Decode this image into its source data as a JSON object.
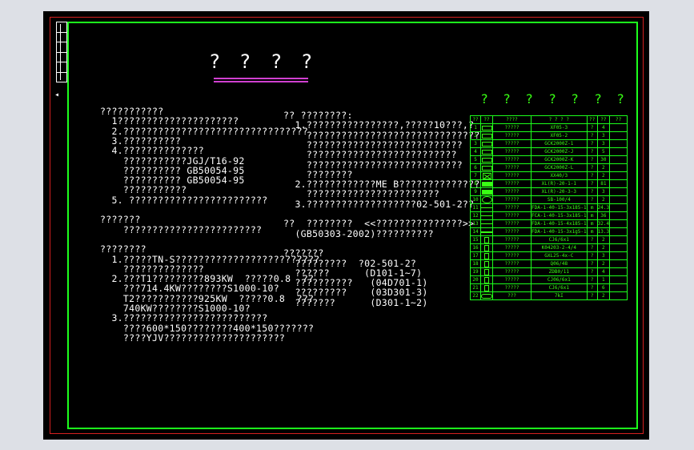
{
  "title_chars": [
    "?",
    "?",
    "?",
    "?"
  ],
  "left_text": [
    "???????????",
    "  1?????????????????????",
    "  2.????????????????????????????????",
    "  3.??????????",
    "  4.??????????????",
    "    ???????????JGJ/T16-92",
    "    ?????????? GB50054-95",
    "    ?????????? GB50054-95",
    "    ???????????",
    "  5. ????????????????????????",
    "",
    "???????",
    "    ????????????????????????",
    "",
    "????????",
    "  1.?????TN-S?????????????????????????",
    "    ??????????????",
    "  2.???T1?????????893KW  ?????0.8  ??",
    "    ???714.4KW????????S1000-10?",
    "    T2???????????925KW  ?????0.8  ???",
    "    740KW????????S1000-10?",
    "  3.?????????????????????????",
    "    ????600*150????????400*150???????",
    "    ????YJV?????????????????????"
  ],
  "mid_text": [
    "?? ????????:",
    "  1.????????????????,?????10???,?",
    "    ??????????????????????????????",
    "    ???????????????????????????",
    "    ??????????????????????????",
    "    ???????????????????????????",
    "    ????????",
    "  2.????????????ME B??????????????",
    "    ???????????????????????",
    "  3.???????????????????02-501-2??",
    "",
    "??  ????????  <<???????????????>>",
    "  (GB50303-2002)??????????",
    "",
    "???????",
    "  ?????????  ?02-501-2?",
    "  ??????      (D101-1~7)",
    "  ??????????   (04D701-1)",
    "  ?????????    (03D301-3)",
    "  ???????      (D301-1~2)"
  ],
  "legend": {
    "heading": [
      "?",
      "?",
      "?",
      "?",
      "?",
      "?",
      "?"
    ],
    "columns": [
      "??",
      "??",
      "????",
      "? ? ? ?",
      "??",
      "??",
      "??"
    ],
    "rows": [
      {
        "no": "1",
        "sym": "rect",
        "name": "?????",
        "model": "XF05-3",
        "unit": "?",
        "qty": "4"
      },
      {
        "no": "2",
        "sym": "rect",
        "name": "?????",
        "model": "XF05-2",
        "unit": "?",
        "qty": "3"
      },
      {
        "no": "3",
        "sym": "rect",
        "name": "?????",
        "model": "GCK2000Z-1",
        "unit": "?",
        "qty": "3"
      },
      {
        "no": "4",
        "sym": "rect",
        "name": "?????",
        "model": "GCK2000Z-J",
        "unit": "?",
        "qty": "5"
      },
      {
        "no": "5",
        "sym": "rect",
        "name": "?????",
        "model": "GCK2000Z-K",
        "unit": "?",
        "qty": "30"
      },
      {
        "no": "6",
        "sym": "rect",
        "name": "?????",
        "model": "GCK2000Z-L",
        "unit": "?",
        "qty": "2"
      },
      {
        "no": "7",
        "sym": "x",
        "name": "?????",
        "model": "XX40/3",
        "unit": "?",
        "qty": "2"
      },
      {
        "no": "8",
        "sym": "rect-dark",
        "name": "?????",
        "model": "XL(R)-20-1-1",
        "unit": "?",
        "qty": "81"
      },
      {
        "no": "9",
        "sym": "rect-dark",
        "name": "?????",
        "model": "XL(R)-20-3-3",
        "unit": "?",
        "qty": "3"
      },
      {
        "no": "10",
        "sym": "circ",
        "name": "?????",
        "model": "SB-100/4",
        "unit": "?",
        "qty": "2"
      },
      {
        "no": "11",
        "sym": "line",
        "name": "?????",
        "model": "FDA-1-40-15-3x185-1",
        "unit": "m",
        "qty": "24.3"
      },
      {
        "no": "12",
        "sym": "line",
        "name": "?????",
        "model": "FCA-1-40-15-3x185-1",
        "unit": "m",
        "qty": "36"
      },
      {
        "no": "13",
        "sym": "line",
        "name": "?????",
        "model": "FDA-1-40-15-4x185-1",
        "unit": "m",
        "qty": "32.4"
      },
      {
        "no": "14",
        "sym": "thick",
        "name": "?????",
        "model": "FDA-1-40-15-3x1g5-1",
        "unit": "m",
        "qty": "13.3"
      },
      {
        "no": "15",
        "sym": "box",
        "name": "?????",
        "model": "CJ6/6x1",
        "unit": "?",
        "qty": "2"
      },
      {
        "no": "16",
        "sym": "box",
        "name": "?????",
        "model": "K04203-2-4/4",
        "unit": "?",
        "qty": "2"
      },
      {
        "no": "17",
        "sym": "box",
        "name": "?????",
        "model": "GXL25-4x-C",
        "unit": "?",
        "qty": "3"
      },
      {
        "no": "18",
        "sym": "box",
        "name": "?????",
        "model": "Q06/48",
        "unit": "?",
        "qty": "2"
      },
      {
        "no": "19",
        "sym": "box",
        "name": "?????",
        "model": "ZDB0/11",
        "unit": "?",
        "qty": "4"
      },
      {
        "no": "20",
        "sym": "box",
        "name": "?????",
        "model": "CJ06/6x1",
        "unit": "?",
        "qty": "1"
      },
      {
        "no": "21",
        "sym": "box",
        "name": "?????",
        "model": "CJ6/6x1",
        "unit": "?",
        "qty": "6"
      },
      {
        "no": "22",
        "sym": "cap",
        "name": "???",
        "model": "7kI",
        "unit": "?",
        "qty": "2"
      }
    ]
  },
  "colors": {
    "background": "#000000",
    "frame_green": "#1cff1c",
    "frame_red": "#d42020",
    "title_underline": "#d040d0",
    "text": "#ffffff",
    "legend_text": "#39ff14"
  }
}
